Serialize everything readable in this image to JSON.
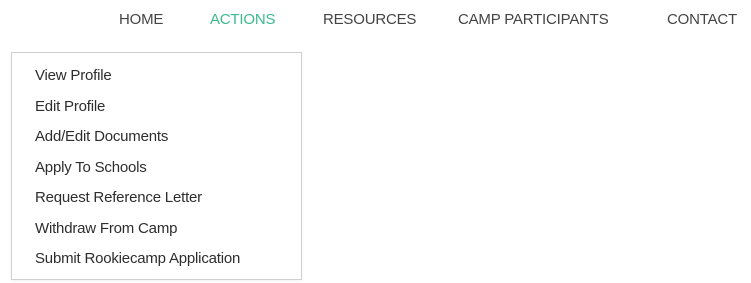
{
  "nav": {
    "items": [
      {
        "label": "HOME"
      },
      {
        "label": "ACTIONS"
      },
      {
        "label": "RESOURCES"
      },
      {
        "label": "CAMP PARTICIPANTS"
      },
      {
        "label": "CONTACT"
      }
    ],
    "active_index": 1,
    "active_color": "#3cb98d"
  },
  "actions_menu": {
    "items": [
      {
        "label": "View Profile"
      },
      {
        "label": "Edit Profile"
      },
      {
        "label": "Add/Edit Documents"
      },
      {
        "label": "Apply To Schools"
      },
      {
        "label": "Request Reference Letter"
      },
      {
        "label": "Withdraw From Camp"
      },
      {
        "label": "Submit Rookiecamp Application"
      }
    ]
  }
}
